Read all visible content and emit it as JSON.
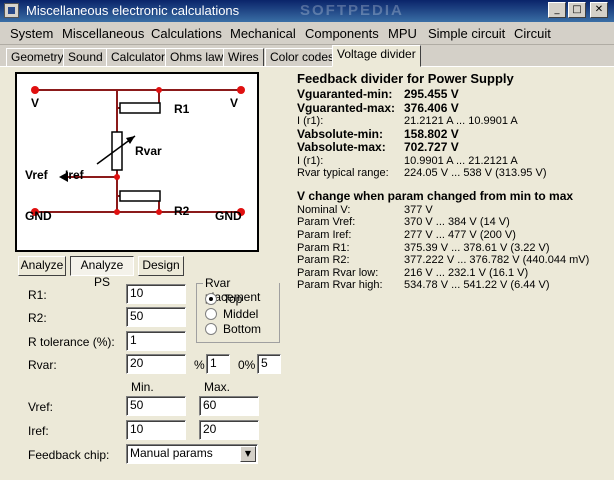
{
  "window": {
    "title": "Miscellaneous electronic calculations",
    "watermark": "SOFTPEDIA",
    "min_glyph": "_",
    "max_glyph": "□",
    "close_glyph": "✕"
  },
  "menu": [
    "System",
    "Miscellaneous",
    "Calculations",
    "Mechanical",
    "Components",
    "MPU",
    "Simple circuit",
    "Circuit"
  ],
  "tabs": [
    "Geometry",
    "Sound",
    "Calculator",
    "Ohms law",
    "Wires",
    "Color codes",
    "Voltage divider"
  ],
  "active_tab": "Voltage divider",
  "circuit": {
    "v_left": "V",
    "v_right": "V",
    "r1": "R1",
    "rvar": "Rvar",
    "vref": "Vref",
    "iref": "Iref",
    "gnd_left": "GND",
    "gnd_right": "GND",
    "r2": "R2",
    "wire_color": "#8b1a1a",
    "node_color": "#e01010"
  },
  "buttons": {
    "analyze": "Analyze",
    "analyze_ps": "Analyze PS",
    "design": "Design"
  },
  "form": {
    "r1_label": "R1:",
    "r1_value": "10",
    "r2_label": "R2:",
    "r2_value": "50",
    "rtol_label": "R tolerance (%):",
    "rtol_value": "1",
    "rvar_label": "Rvar:",
    "rvar_value": "20",
    "pct_sign": "%",
    "rvar_tol": "1",
    "zero_pct": "0%",
    "rvar_extra": "5",
    "min_header": "Min.",
    "max_header": "Max.",
    "vref_label": "Vref:",
    "vref_min": "50",
    "vref_max": "60",
    "iref_label": "Iref:",
    "iref_min": "10",
    "iref_max": "20",
    "chip_label": "Feedback chip:",
    "chip_value": "Manual params",
    "dropdown_arrow": "▼"
  },
  "placement": {
    "title": "Rvar placement",
    "options": [
      "Top",
      "Middel",
      "Bottom"
    ],
    "selected": "Top"
  },
  "results": {
    "title1": "Feedback divider for Power Supply",
    "vgmin_k": "Vguaranted-min:",
    "vgmin_v": "295.455 V",
    "vgmax_k": "Vguaranted-max:",
    "vgmax_v": "376.406 V",
    "ir1_k": "I (r1):",
    "ir1_v": "21.2121 A ... 10.9901 A",
    "vamin_k": "Vabsolute-min:",
    "vamin_v": "158.802 V",
    "vamax_k": "Vabsolute-max:",
    "vamax_v": "702.727 V",
    "ir1b_k": "I (r1):",
    "ir1b_v": "10.9901 A ... 21.2121 A",
    "rvtr_k": "Rvar typical range:",
    "rvtr_v": "224.05 V ... 538 V (313.95 V)",
    "title2": "V change when param changed from min to max",
    "nom_k": "Nominal V:",
    "nom_v": "377 V",
    "pvref_k": "Param Vref:",
    "pvref_v": "370 V ... 384 V (14 V)",
    "piref_k": "Param Iref:",
    "piref_v": "277 V ... 477 V (200 V)",
    "pr1_k": "Param R1:",
    "pr1_v": "375.39 V ... 378.61 V (3.22 V)",
    "pr2_k": "Param R2:",
    "pr2_v": "377.222 V ... 376.782 V (440.044 mV)",
    "prl_k": "Param Rvar low:",
    "prl_v": "216 V ... 232.1 V (16.1 V)",
    "prh_k": "Param Rvar high:",
    "prh_v": "534.78 V ... 541.22 V (6.44 V)"
  }
}
